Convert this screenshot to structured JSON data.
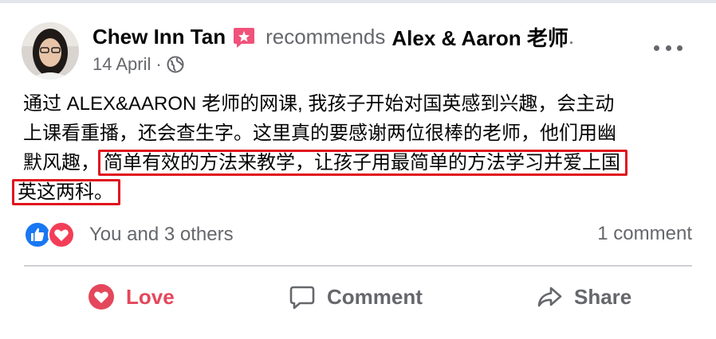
{
  "post": {
    "author": "Chew Inn Tan",
    "verb": "recommends",
    "page": "Alex & Aaron 老师",
    "date": "14 April",
    "audience_icon": "globe-icon",
    "text_lines": [
      "通过 ALEX&AARON 老师的网课, 我孩子开始对国英感到兴趣，会主动",
      "上课看重播，还会查生字。这里真的要感谢两位很棒的老师，他们用幽"
    ],
    "line3_plain": "默风趣，",
    "line3_highlight": "简单有效的方法来教学，让孩子用最简单的方法学习并爱上国",
    "line4_highlight": "英这两科。"
  },
  "reactions": {
    "summary": "You and 3 others",
    "comments": "1 comment",
    "icons": [
      "like-icon",
      "love-icon"
    ]
  },
  "actions": {
    "love_label": "Love",
    "comment_label": "Comment",
    "share_label": "Share"
  },
  "colors": {
    "highlight_border": "#e0141e",
    "love": "#e4475b",
    "like_blue": "#1877f2",
    "muted_text": "#65676b"
  }
}
